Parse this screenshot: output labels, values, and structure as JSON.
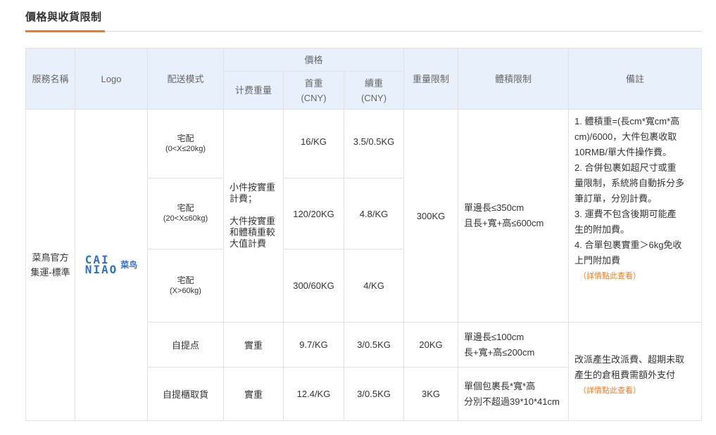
{
  "section": {
    "title": "價格與收貨限制"
  },
  "table": {
    "headers": {
      "service_name": "服務名稱",
      "logo": "Logo",
      "delivery_mode": "配送模式",
      "price": "價格",
      "billing_weight": "计费重量",
      "first_weight": "首重",
      "first_weight_unit": "(CNY)",
      "extra_weight": "續重",
      "extra_weight_unit": "(CNY)",
      "weight_limit": "重量限制",
      "volume_limit": "體積限制",
      "remarks": "備註"
    },
    "service": {
      "name_line1": "菜鳥官方",
      "name_line2": "集運-標準",
      "logo_line1": "CAI",
      "logo_line2": "NIAO",
      "logo_cn": "菜鸟"
    },
    "home_delivery": {
      "billing_weight_line1": "小件按實重",
      "billing_weight_line2": "計費；",
      "billing_weight_line3": "大件按實重",
      "billing_weight_line4": "和體積重較",
      "billing_weight_line5": "大值計費",
      "weight_limit": "300KG",
      "volume_limit_line1": "單邊長≤350cm",
      "volume_limit_line2": "且長+寬+高≤600cm",
      "rows": [
        {
          "mode": "宅配",
          "range": "(0<X≤20kg)",
          "first": "16/KG",
          "extra": "3.5/0.5KG"
        },
        {
          "mode": "宅配",
          "range": "(20<X≤60kg)",
          "first": "120/20KG",
          "extra": "4.8/KG"
        },
        {
          "mode": "宅配",
          "range": "(X>60kg)",
          "first": "300/60KG",
          "extra": "4/KG"
        }
      ],
      "notes": [
        "1. 體積重=(長cm*寬cm*高",
        "cm)/6000，大件包裹收取",
        "10RMB/單大件操作費。",
        "2. 合併包裹如超尺寸或重",
        "量限制，系統將自動拆分多",
        "筆訂單，分別計費。",
        "3. 運費不包含後期可能產",
        "生的附加費。",
        "4. 合單包裹實重＞6kg免收",
        "上門附加費"
      ],
      "detail_link": "（詳情點此查看）"
    },
    "pickup_point": {
      "mode": "自提点",
      "billing_weight": "實重",
      "first": "9.7/KG",
      "extra": "3/0.5KG",
      "weight_limit": "20KG",
      "volume_limit_line1": "單邊長≤100cm",
      "volume_limit_line2": "長+寬+高≤200cm"
    },
    "locker": {
      "mode": "自提櫃取貨",
      "billing_weight": "實重",
      "first": "12.4/KG",
      "extra": "3/0.5KG",
      "weight_limit": "3KG",
      "volume_limit_line1": "單個包裹長*寬*高",
      "volume_limit_line2": "分別不超過39*10*41cm"
    },
    "self_pickup_notes": {
      "line1": "改派產生改派費、超期未取",
      "line2": "產生的倉租費需額外支付",
      "detail_link": "（詳情點此查看）"
    }
  }
}
